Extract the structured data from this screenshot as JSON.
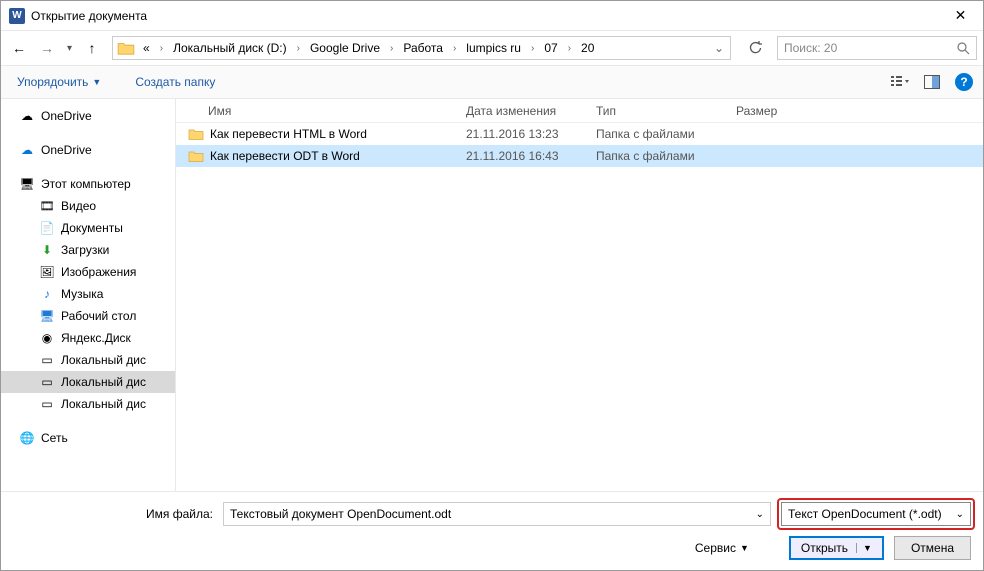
{
  "title": "Открытие документа",
  "nav": {
    "dropdown_chev": "▾"
  },
  "path": {
    "dots": "«",
    "segments": [
      "Локальный диск (D:)",
      "Google Drive",
      "Работа",
      "lumpics ru",
      "07",
      "20"
    ]
  },
  "search": {
    "placeholder": "Поиск: 20"
  },
  "toolbar": {
    "organize": "Упорядочить",
    "newfolder": "Создать папку"
  },
  "sidebar": {
    "onedrive": "OneDrive",
    "onedrive2": "OneDrive",
    "pc": "Этот компьютер",
    "video": "Видео",
    "documents": "Документы",
    "downloads": "Загрузки",
    "images": "Изображения",
    "music": "Музыка",
    "desktop": "Рабочий стол",
    "yandex": "Яндекс.Диск",
    "localdisk1": "Локальный дис",
    "localdisk2": "Локальный дис",
    "localdisk3": "Локальный дис",
    "network": "Сеть"
  },
  "columns": {
    "name": "Имя",
    "date": "Дата изменения",
    "type": "Тип",
    "size": "Размер"
  },
  "files": [
    {
      "name": "Как перевести HTML в Word",
      "date": "21.11.2016 13:23",
      "type": "Папка с файлами",
      "selected": false
    },
    {
      "name": "Как перевести ODT в Word",
      "date": "21.11.2016 16:43",
      "type": "Папка с файлами",
      "selected": true
    }
  ],
  "footer": {
    "filename_label": "Имя файла:",
    "filename_value": "Текстовый документ OpenDocument.odt",
    "filetype_value": "Текст OpenDocument (*.odt)",
    "service": "Сервис",
    "open": "Открыть",
    "cancel": "Отмена"
  }
}
